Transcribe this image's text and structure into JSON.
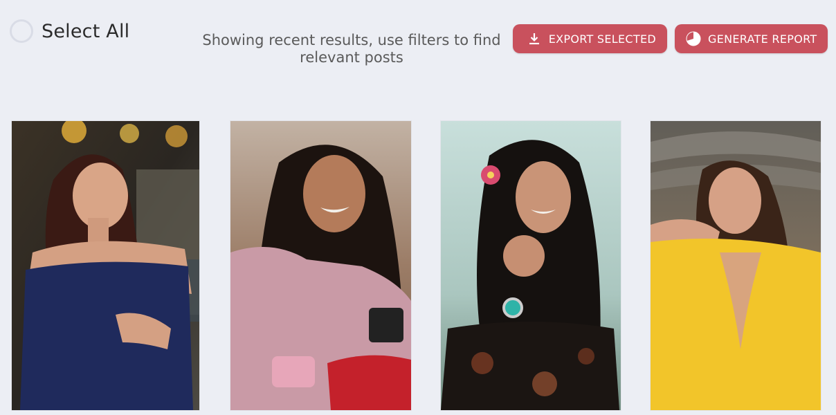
{
  "header": {
    "select_all_label": "Select All",
    "info_text": "Showing recent results, use filters to find relevant posts",
    "export_button_label": "EXPORT SELECTED",
    "report_button_label": "GENERATE REPORT"
  },
  "icons": {
    "export": "download-icon",
    "report": "pie-chart-icon"
  },
  "colors": {
    "accent": "#c9515d",
    "background": "#eceef4",
    "checkbox_border": "#d9dce6"
  },
  "posts": [
    {
      "icon": "photo-portrait"
    },
    {
      "icon": "photo-portrait"
    },
    {
      "icon": "photo-portrait"
    },
    {
      "icon": "photo-portrait"
    }
  ]
}
